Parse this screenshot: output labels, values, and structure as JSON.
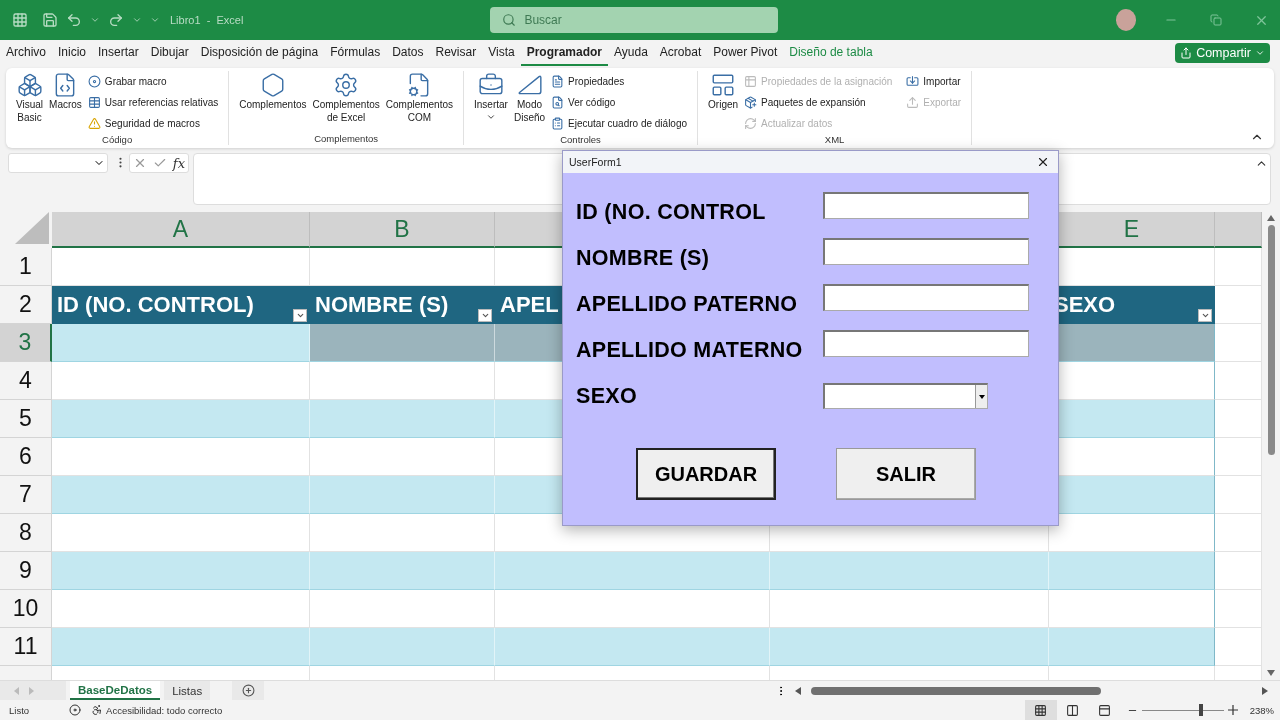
{
  "title_bar": {
    "title": "Libro1  -  Excel",
    "search": {
      "placeholder": "Buscar"
    }
  },
  "menu_tabs": [
    {
      "label": "Archivo",
      "kind": "tab",
      "selected": false
    },
    {
      "label": "Inicio",
      "kind": "tab",
      "selected": false
    },
    {
      "label": "Insertar",
      "kind": "tab",
      "selected": false
    },
    {
      "label": "Dibujar",
      "kind": "tab",
      "selected": false
    },
    {
      "label": "Disposición de página",
      "kind": "tab",
      "selected": false
    },
    {
      "label": "Fórmulas",
      "kind": "tab",
      "selected": false
    },
    {
      "label": "Datos",
      "kind": "tab",
      "selected": false
    },
    {
      "label": "Revisar",
      "kind": "tab",
      "selected": false
    },
    {
      "label": "Vista",
      "kind": "tab",
      "selected": false
    },
    {
      "label": "Programador",
      "kind": "tab",
      "selected": true
    },
    {
      "label": "Ayuda",
      "kind": "tab",
      "selected": false
    },
    {
      "label": "Acrobat",
      "kind": "tab",
      "selected": false
    },
    {
      "label": "Power Pivot",
      "kind": "tab",
      "selected": false
    },
    {
      "label": "Diseño de tabla",
      "kind": "contextual",
      "selected": false
    }
  ],
  "share_button": "Compartir",
  "ribbon": {
    "groups": [
      {
        "label": "Código",
        "items": [
          {
            "kind": "large",
            "label": "Visual\nBasic"
          },
          {
            "kind": "large",
            "label": "Macros"
          },
          {
            "kind": "small",
            "label": "Grabar macro",
            "disabled": false
          },
          {
            "kind": "small",
            "label": "Usar referencias relativas",
            "disabled": false
          },
          {
            "kind": "small",
            "label": "Seguridad de macros",
            "disabled": false
          }
        ]
      },
      {
        "label": "Complementos",
        "items": [
          {
            "kind": "large",
            "label": "Complementos"
          },
          {
            "kind": "large",
            "label": "Complementos\nde Excel"
          },
          {
            "kind": "large",
            "label": "Complementos\nCOM"
          }
        ]
      },
      {
        "label": "Controles",
        "items": [
          {
            "kind": "large",
            "label": "Insertar",
            "menu": true
          },
          {
            "kind": "large",
            "label": "Modo\nDiseño"
          },
          {
            "kind": "small",
            "label": "Propiedades",
            "disabled": false
          },
          {
            "kind": "small",
            "label": "Ver código",
            "disabled": false
          },
          {
            "kind": "small",
            "label": "Ejecutar cuadro de diálogo",
            "disabled": false
          }
        ]
      },
      {
        "label": "XML",
        "items": [
          {
            "kind": "large",
            "label": "Origen"
          },
          {
            "kind": "small",
            "label": "Propiedades de la asignación",
            "disabled": true
          },
          {
            "kind": "small",
            "label": "Paquetes de expansión",
            "disabled": false
          },
          {
            "kind": "small",
            "label": "Actualizar datos",
            "disabled": true
          },
          {
            "kind": "small",
            "label": "Importar",
            "disabled": false
          },
          {
            "kind": "small",
            "label": "Exportar",
            "disabled": true
          }
        ]
      }
    ]
  },
  "formula_bar": {
    "function_label": "fx"
  },
  "sheet": {
    "columns": [
      {
        "header": "A"
      },
      {
        "header": "B"
      },
      {},
      {},
      {
        "header": "E"
      },
      {}
    ],
    "rows": [
      {
        "number": "1",
        "kind": "blank",
        "selected": false
      },
      {
        "number": "2",
        "kind": "header",
        "selected": false,
        "cells": [
          {
            "text": "ID (NO. CONTROL)",
            "filter": true
          },
          {
            "text": "NOMBRE (S)",
            "filter": true
          },
          {
            "text": "APEL"
          },
          {},
          {
            "text": "SEXO",
            "filter": true
          }
        ]
      },
      {
        "number": "3",
        "kind": "data",
        "striped": true,
        "selected": true
      },
      {
        "number": "4",
        "kind": "data",
        "striped": false,
        "selected": false
      },
      {
        "number": "5",
        "kind": "data",
        "striped": true,
        "selected": false
      },
      {
        "number": "6",
        "kind": "data",
        "striped": false,
        "selected": false
      },
      {
        "number": "7",
        "kind": "data",
        "striped": true,
        "selected": false
      },
      {
        "number": "8",
        "kind": "data",
        "striped": false,
        "selected": false
      },
      {
        "number": "9",
        "kind": "data",
        "striped": true,
        "selected": false
      },
      {
        "number": "10",
        "kind": "data",
        "striped": false,
        "selected": false
      },
      {
        "number": "11",
        "kind": "data",
        "striped": true,
        "selected": false
      }
    ]
  },
  "sheet_tabs": [
    {
      "label": "BaseDeDatos",
      "selected": true
    },
    {
      "label": "Listas",
      "selected": false
    }
  ],
  "status_bar": {
    "status": "Listo",
    "accessibility": "Accesibilidad: todo correcto",
    "views": [
      {
        "selected": true
      },
      {
        "selected": false
      },
      {
        "selected": false
      }
    ],
    "zoom": {
      "level": 0.72,
      "reading": "238%"
    }
  },
  "dialog": {
    "title": "UserForm1",
    "fields": [
      {
        "kind": "text",
        "label": "ID (NO. CONTROL"
      },
      {
        "kind": "text",
        "label": "NOMBRE (S)"
      },
      {
        "kind": "text",
        "label": "APELLIDO PATERNO"
      },
      {
        "kind": "text",
        "label": "APELLIDO MATERNO"
      },
      {
        "kind": "combo",
        "label": "SEXO"
      }
    ],
    "buttons": [
      {
        "label": "GUARDAR",
        "focused": true
      },
      {
        "label": "SALIR",
        "focused": false
      }
    ]
  }
}
